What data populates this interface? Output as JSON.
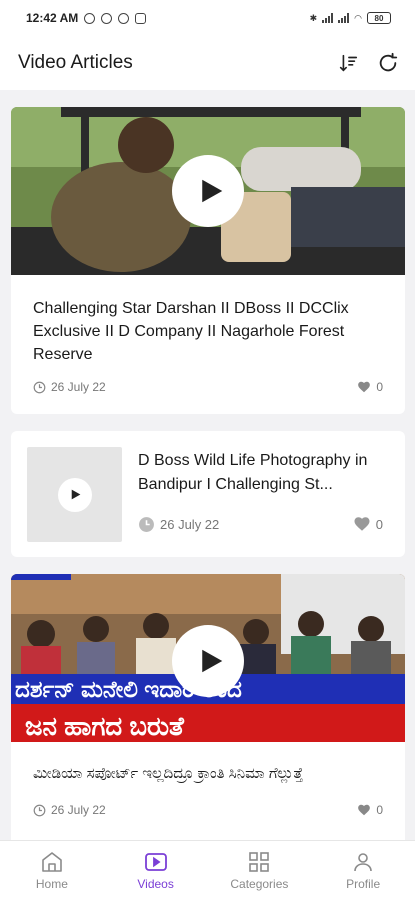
{
  "status": {
    "time": "12:42 AM",
    "battery": "80"
  },
  "header": {
    "title": "Video Articles"
  },
  "articles": [
    {
      "title": "Challenging Star Darshan II DBoss II DCClix Exclusive II D Company II Nagarhole Forest Reserve",
      "date": "26 July 22",
      "likes": "0"
    },
    {
      "title": "D Boss Wild Life Photography in Bandipur I Challenging St...",
      "date": "26 July 22",
      "likes": "0"
    },
    {
      "title": "ಮೀಡಿಯಾ ಸಪೋರ್ಟ್ ಇಲ್ಲದಿದ್ರೂ ಕ್ರಾಂತಿ ಸಿನಿಮಾ ಗೆಲ್ಲುತ್ತೆ",
      "date": "26 July 22",
      "likes": "0",
      "banner_line1": "ದರ್ಶನ್ ಮನೇಲಿ ಇದಾರೆ ಅಂದ",
      "banner_line2": "ಜನ ಹಾಗದ ಬರುತೆ"
    }
  ],
  "nav": [
    {
      "label": "Home",
      "icon": "home-icon"
    },
    {
      "label": "Videos",
      "icon": "video-icon"
    },
    {
      "label": "Categories",
      "icon": "grid-icon"
    },
    {
      "label": "Profile",
      "icon": "person-icon"
    }
  ],
  "colors": {
    "accent": "#7b3fd6",
    "banner_blue": "#1f2fb5",
    "banner_red": "#d11919"
  }
}
